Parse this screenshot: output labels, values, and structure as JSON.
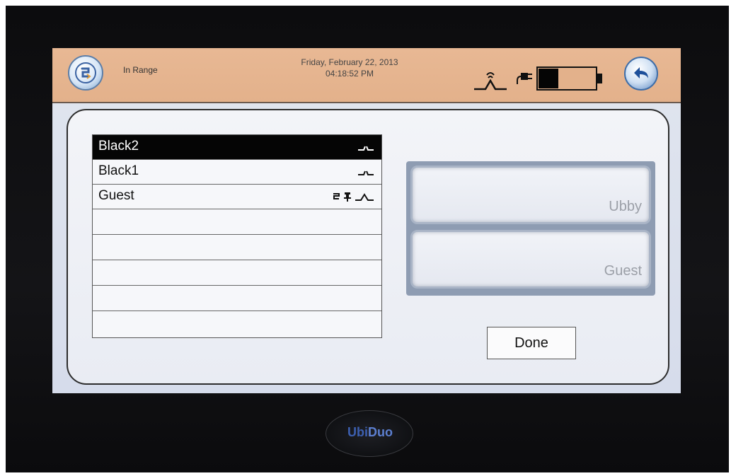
{
  "status_bar": {
    "connection_status": "In Range",
    "date": "Friday, February 22, 2013",
    "time": "04:18:52 PM",
    "icons": [
      "app-logo-icon",
      "signal-icon",
      "plug-icon",
      "battery-icon",
      "back-icon"
    ],
    "battery_level": 0.35
  },
  "device_list": {
    "items": [
      {
        "label": "Black2",
        "selected": true,
        "icons": [
          "signal-icon"
        ]
      },
      {
        "label": "Black1",
        "selected": false,
        "icons": [
          "signal-icon"
        ]
      },
      {
        "label": "Guest",
        "selected": false,
        "icons": [
          "sync-icon",
          "pin-icon",
          "signal-icon"
        ]
      }
    ],
    "empty_rows": 5
  },
  "buttons": {
    "ubby_label": "Ubby",
    "guest_label": "Guest",
    "done_label": "Done"
  },
  "brand": {
    "name_part1": "Ubi",
    "name_part2": "Duo"
  }
}
